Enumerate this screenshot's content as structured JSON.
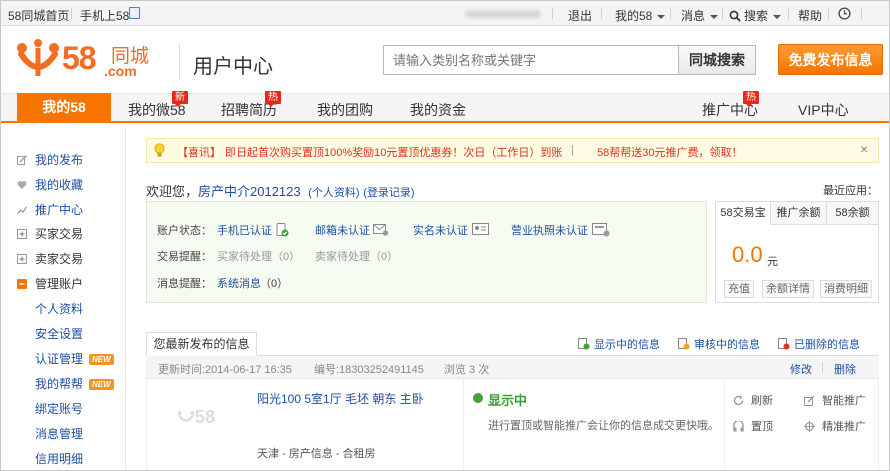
{
  "topbar": {
    "home_link": "58同城首页",
    "mobile_link": "手机上58",
    "logout": "退出",
    "my58": "我的58",
    "messages": "消息",
    "search": "搜索",
    "help": "帮助"
  },
  "header": {
    "logo_number": "58",
    "logo_name": "同城",
    "logo_domain": ".com",
    "title": "用户中心",
    "search_placeholder": "请输入类别名称或关键字",
    "search_button": "同城搜索",
    "post_button": "免费发布信息"
  },
  "nav": {
    "items": [
      {
        "label": "我的58",
        "active": true
      },
      {
        "label": "我的微58",
        "badge": "新"
      },
      {
        "label": "招聘简历",
        "badge": "热"
      },
      {
        "label": "我的团购"
      },
      {
        "label": "我的资金"
      },
      {
        "label": "推广中心",
        "badge": "热"
      },
      {
        "label": "VIP中心"
      }
    ]
  },
  "sidebar": {
    "my_posts": "我的发布",
    "my_favorites": "我的收藏",
    "promo_center": "推广中心",
    "buy_trade": "买家交易",
    "sell_trade": "卖家交易",
    "manage_account": "管理账户",
    "sub": {
      "profile": "个人资料",
      "security": "安全设置",
      "certification": "认证管理",
      "bangbang": "我的帮帮",
      "bind": "绑定账号",
      "message_mgmt": "消息管理",
      "credit": "信用明细"
    },
    "new_badge": "NEW"
  },
  "notice": {
    "tag": "【喜讯】",
    "text": "即日起首次购买置顶100%奖励10元置顶优惠券！次日（工作日）到账",
    "separator": "|",
    "promo": "58帮帮送30元推广费，领取！",
    "close": "×"
  },
  "welcome": {
    "greeting": "欢迎您，",
    "username": "房产中介2012123",
    "profile_link": "(个人资料)",
    "login_log": "(登录记录)",
    "recent_apps": "最近应用："
  },
  "account_status": {
    "label": "账户状态：",
    "phone": "手机已认证",
    "email": "邮箱未认证",
    "realname": "实名未认证",
    "license": "营业执照未认证",
    "trade_label": "交易提醒：",
    "buyer_pending": "买家待处理（0）",
    "seller_pending": "卖家待处理（0）",
    "msg_label": "消息提醒：",
    "system_msg": "系统消息",
    "system_msg_count": "（0）"
  },
  "wallet": {
    "tabs": [
      "58交易宝",
      "推广余额",
      "58余额"
    ],
    "amount": "0.0",
    "unit": "元",
    "recharge": "充值",
    "balance_detail": "余额详情",
    "consume_detail": "消费明细"
  },
  "latest_info": {
    "tab": "您最新发布的信息",
    "showing_link": "显示中的信息",
    "reviewing_link": "审核中的信息",
    "deleted_link": "已删除的信息",
    "update_time": "更新时间:2014-06-17 16:35",
    "id": "编号:18303252491145",
    "views": "浏览 3 次",
    "edit": "修改",
    "delete": "删除",
    "thumb_placeholder": "58",
    "listing_title": "阳光100 5室1厅 毛坯 朝东 主卧",
    "location": "天津 - 房产信息 - 合租房",
    "status": "显示中",
    "status_desc": "进行置顶或智能推广会让你的信息成交更快哦。",
    "refresh": "刷新",
    "smart_promo": "智能推广",
    "top": "置顶",
    "precise_promo": "精准推广"
  },
  "colors": {
    "brand_orange": "#f77400",
    "link_blue": "#1e50a2",
    "status_green": "#3a9d35",
    "notice_red": "#e0301e"
  }
}
